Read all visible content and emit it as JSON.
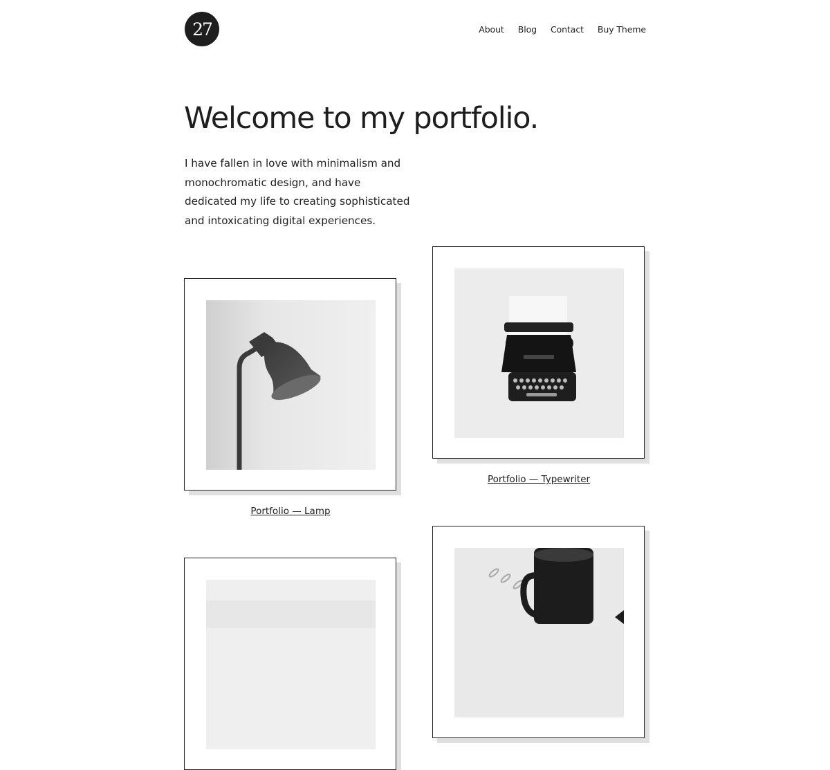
{
  "site": {
    "logo_text": "27"
  },
  "nav": {
    "items": [
      {
        "label": "About"
      },
      {
        "label": "Blog"
      },
      {
        "label": "Contact"
      },
      {
        "label": "Buy Theme"
      }
    ]
  },
  "hero": {
    "title": "Welcome to my portfolio.",
    "intro": "I have fallen in love with minimalism and monochromatic design, and have dedicated my life to creating sophisticated and intoxicating digital experiences."
  },
  "portfolio": {
    "items": [
      {
        "caption": "Portfolio — Lamp",
        "image": "lamp-photo"
      },
      {
        "caption": "Portfolio — Typewriter",
        "image": "typewriter-photo"
      },
      {
        "caption": "",
        "image": "light-photo"
      },
      {
        "caption": "",
        "image": "mug-photo"
      }
    ]
  },
  "colors": {
    "text": "#1e1e1e",
    "background": "#ffffff",
    "shadow": "#e0e0e0"
  }
}
